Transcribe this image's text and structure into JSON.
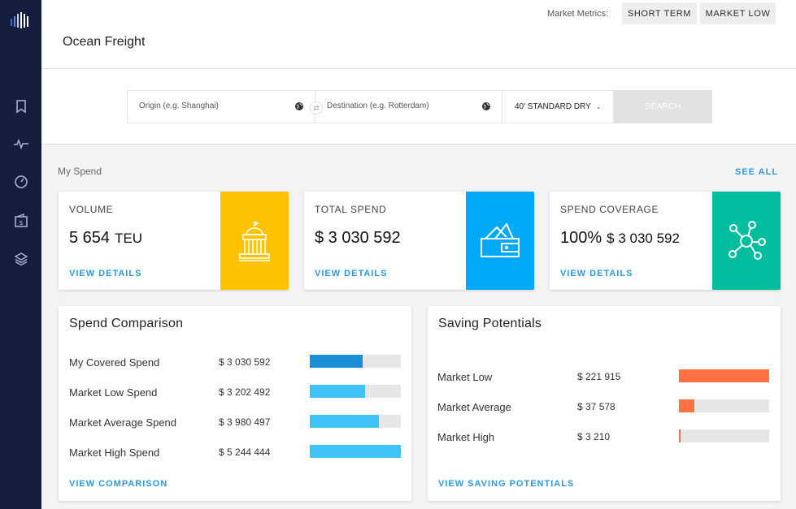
{
  "header": {
    "title": "Ocean Freight",
    "metrics_label": "Market Metrics:",
    "chips": [
      "SHORT TERM",
      "MARKET LOW"
    ]
  },
  "sidebar": {
    "logo_icon": "bars-logo-icon",
    "items": [
      {
        "icon": "bookmark-icon"
      },
      {
        "icon": "activity-icon"
      },
      {
        "icon": "gauge-icon"
      },
      {
        "icon": "wallet-icon"
      },
      {
        "icon": "layers-icon"
      }
    ]
  },
  "search": {
    "origin_placeholder": "Origin (e.g. Shanghai)",
    "destination_placeholder": "Destination (e.g. Rotterdam)",
    "container": "40' STANDARD DRY",
    "button": "SEARCH"
  },
  "my_spend": {
    "label": "My Spend",
    "see_all": "SEE ALL",
    "kpis": [
      {
        "label": "VOLUME",
        "value": "5 654",
        "unit": "TEU",
        "link": "VIEW DETAILS",
        "color": "#fdc300",
        "icon": "building-icon"
      },
      {
        "label": "TOTAL SPEND",
        "value": "$ 3 030 592",
        "unit": "",
        "link": "VIEW DETAILS",
        "color": "#00aaf8",
        "icon": "wallet-icon"
      },
      {
        "label": "SPEND COVERAGE",
        "value": "100%",
        "unit": "$ 3 030 592",
        "link": "VIEW DETAILS",
        "color": "#00bd9d",
        "icon": "network-icon"
      }
    ]
  },
  "spend_comparison": {
    "title": "Spend Comparison",
    "link": "VIEW COMPARISON",
    "rows": [
      {
        "label": "My Covered Spend",
        "amount": "$ 3 030 592",
        "fill": 0.58,
        "color": "#1a8fd6"
      },
      {
        "label": "Market Low Spend",
        "amount": "$ 3 202 492",
        "fill": 0.61,
        "color": "#3fc3f7"
      },
      {
        "label": "Market Average Spend",
        "amount": "$ 3 980 497",
        "fill": 0.76,
        "color": "#3fc3f7"
      },
      {
        "label": "Market High Spend",
        "amount": "$ 5 244 444",
        "fill": 1.0,
        "color": "#3fc3f7"
      }
    ]
  },
  "saving_potentials": {
    "title": "Saving Potentials",
    "link": "VIEW SAVING POTENTIALS",
    "rows": [
      {
        "label": "Market Low",
        "amount": "$ 221 915",
        "fill": 1.0,
        "color": "#ff7043"
      },
      {
        "label": "Market Average",
        "amount": "$ 37 578",
        "fill": 0.17,
        "color": "#ff7043"
      },
      {
        "label": "Market High",
        "amount": "$ 3 210",
        "fill": 0.015,
        "color": "#ff7043"
      }
    ]
  }
}
